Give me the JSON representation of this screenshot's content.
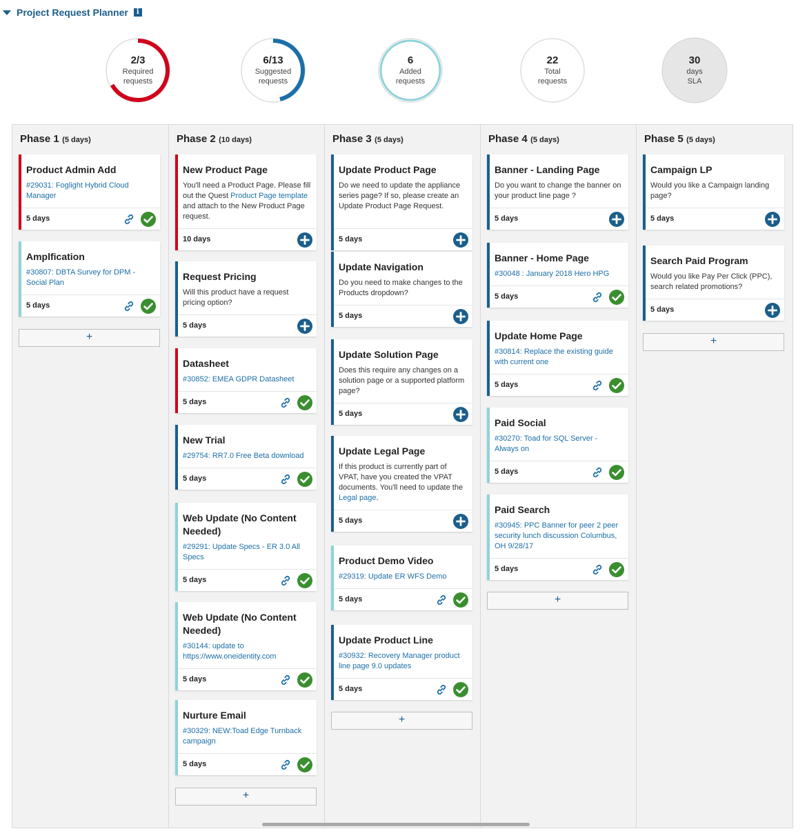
{
  "header": {
    "title": "Project Request Planner",
    "info_glyph": "i"
  },
  "stats": [
    {
      "value": "2/3",
      "label1": "Required",
      "label2": "requests",
      "progress": 0.667,
      "color": "#d0021b"
    },
    {
      "value": "6/13",
      "label1": "Suggested",
      "label2": "requests",
      "progress": 0.462,
      "color": "#1b6fa8"
    },
    {
      "value": "6",
      "label1": "Added",
      "label2": "requests",
      "progress": 1.0,
      "color": "#8fd3d9"
    },
    {
      "value": "22",
      "label1": "Total",
      "label2": "requests",
      "progress": 0,
      "color": "#dddddd"
    },
    {
      "value": "30",
      "label1": "days",
      "label2": "SLA",
      "progress": 0,
      "color": "#dddddd",
      "filled": true
    }
  ],
  "colors": {
    "required": "#d0021b",
    "suggested": "#1b5e8c",
    "added": "#8fd3d9",
    "check": "#3a8e2f",
    "link": "#1b6fa8"
  },
  "phases": [
    {
      "name": "Phase 1",
      "days": "(5 days)",
      "cards": [
        {
          "title": "Product Admin Add",
          "link": "#29031: Foglight Hybrid Cloud Manager",
          "days": "5 days",
          "type": "required",
          "actions": "done"
        },
        {
          "title": "Amplfication",
          "link": "#30807: DBTA Survey for DPM - Social Plan",
          "days": "5 days",
          "type": "added",
          "actions": "done"
        }
      ],
      "add_label": "+"
    },
    {
      "name": "Phase 2",
      "days": "(10 days)",
      "cards": [
        {
          "title": "New Product Page",
          "desc_parts": [
            "You'll need a Product Page. Please fill out the Quest ",
            "Product Page template",
            " and attach to the New Product Page request."
          ],
          "days": "10 days",
          "type": "required",
          "actions": "add"
        },
        {
          "title": "Request Pricing",
          "desc": "Will this product have a request pricing option?",
          "days": "5 days",
          "type": "suggested",
          "actions": "add"
        },
        {
          "title": "Datasheet",
          "link": "#30852: EMEA GDPR Datasheet",
          "days": "5 days",
          "type": "required",
          "actions": "done"
        },
        {
          "title": "New Trial",
          "link": "#29754: RR7.0 Free Beta download",
          "days": "5 days",
          "type": "suggested",
          "actions": "done"
        },
        {
          "title": "Web Update (No Content Needed)",
          "link": "#29291: Update Specs - ER 3.0 All Specs",
          "days": "5 days",
          "type": "added",
          "actions": "done"
        },
        {
          "title": "Web Update (No Content Needed)",
          "link": "#30144: update to https://www.oneidentity.com",
          "days": "5 days",
          "type": "added",
          "actions": "done"
        },
        {
          "title": "Nurture Email",
          "link": "#30329: NEW:Toad Edge Turnback campaign",
          "days": "5 days",
          "type": "added",
          "actions": "done"
        }
      ],
      "add_label": "+"
    },
    {
      "name": "Phase 3",
      "days": "(5 days)",
      "cards": [
        {
          "title": "Update Product Page",
          "desc": "Do we need to update the appliance series page? If so, please create an Update Product Page Request.",
          "days": "5 days",
          "type": "suggested",
          "actions": "add"
        },
        {
          "title": "Update Navigation",
          "desc": "Do you need to make changes to the Products dropdown?",
          "days": "5 days",
          "type": "suggested",
          "actions": "add"
        },
        {
          "title": "Update Solution Page",
          "desc": "Does this require any changes on a solution page or a supported platform page?",
          "days": "5 days",
          "type": "suggested",
          "actions": "add"
        },
        {
          "title": "Update Legal Page",
          "desc_parts": [
            "If this product is currently part of VPAT, have you created the VPAT documents. You'll need to update the ",
            "Legal page",
            "."
          ],
          "days": "5 days",
          "type": "suggested",
          "actions": "add"
        },
        {
          "title": "Product Demo Video",
          "link": "#29319: Update ER WFS Demo",
          "days": "5 days",
          "type": "added",
          "actions": "done"
        },
        {
          "title": "Update Product Line",
          "link": "#30932: Recovery Manager product line page 9.0 updates",
          "days": "5 days",
          "type": "suggested",
          "actions": "done"
        }
      ],
      "add_label": "+"
    },
    {
      "name": "Phase 4",
      "days": "(5 days)",
      "cards": [
        {
          "title": "Banner - Landing Page",
          "desc": "Do you want to change the banner on your product line page ?",
          "days": "5 days",
          "type": "suggested",
          "actions": "add"
        },
        {
          "title": "Banner - Home Page",
          "link": "#30048 : January 2018 Hero HPG",
          "days": "5 days",
          "type": "suggested",
          "actions": "done"
        },
        {
          "title": "Update Home Page",
          "link": "#30814: Replace the existing guide with current one",
          "days": "5 days",
          "type": "suggested",
          "actions": "done"
        },
        {
          "title": "Paid Social",
          "link": "#30270: Toad for SQL Server - Always on",
          "days": "5 days",
          "type": "added",
          "actions": "done"
        },
        {
          "title": "Paid Search",
          "link": "#30945: PPC Banner for peer 2 peer security lunch discussion Columbus, OH 9/28/17",
          "days": "5 days",
          "type": "added",
          "actions": "done"
        }
      ],
      "add_label": "+"
    },
    {
      "name": "Phase 5",
      "days": "(5 days)",
      "cards": [
        {
          "title": "Campaign LP",
          "desc": "Would you like a Campaign landing page?",
          "days": "5 days",
          "type": "suggested",
          "actions": "add"
        },
        {
          "title": "Search Paid Program",
          "desc": "Would you like Pay Per Click (PPC), search related promotions?",
          "days": "5 days",
          "type": "suggested",
          "actions": "add"
        }
      ],
      "add_label": "+"
    }
  ]
}
